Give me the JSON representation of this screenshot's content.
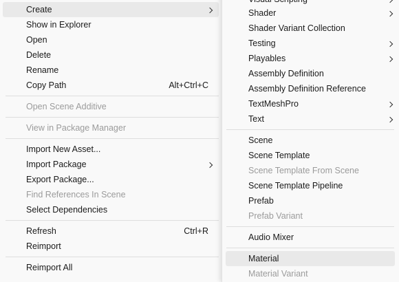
{
  "main_menu": {
    "items": [
      {
        "label": "Create",
        "has_submenu": true,
        "highlighted": true
      },
      {
        "label": "Show in Explorer"
      },
      {
        "label": "Open"
      },
      {
        "label": "Delete"
      },
      {
        "label": "Rename"
      },
      {
        "label": "Copy Path",
        "shortcut": "Alt+Ctrl+C"
      },
      {
        "label": "Open Scene Additive",
        "disabled": true
      },
      {
        "label": "View in Package Manager",
        "disabled": true
      },
      {
        "label": "Import New Asset..."
      },
      {
        "label": "Import Package",
        "has_submenu": true
      },
      {
        "label": "Export Package..."
      },
      {
        "label": "Find References In Scene",
        "disabled": true
      },
      {
        "label": "Select Dependencies"
      },
      {
        "label": "Refresh",
        "shortcut": "Ctrl+R"
      },
      {
        "label": "Reimport"
      },
      {
        "label": "Reimport All"
      }
    ]
  },
  "sub_menu": {
    "items": [
      {
        "label": "Visual Scripting",
        "has_submenu": true
      },
      {
        "label": "Shader",
        "has_submenu": true
      },
      {
        "label": "Shader Variant Collection"
      },
      {
        "label": "Testing",
        "has_submenu": true
      },
      {
        "label": "Playables",
        "has_submenu": true
      },
      {
        "label": "Assembly Definition"
      },
      {
        "label": "Assembly Definition Reference"
      },
      {
        "label": "TextMeshPro",
        "has_submenu": true
      },
      {
        "label": "Text",
        "has_submenu": true
      },
      {
        "label": "Scene"
      },
      {
        "label": "Scene Template"
      },
      {
        "label": "Scene Template From Scene",
        "disabled": true
      },
      {
        "label": "Scene Template Pipeline"
      },
      {
        "label": "Prefab"
      },
      {
        "label": "Prefab Variant",
        "disabled": true
      },
      {
        "label": "Audio Mixer"
      },
      {
        "label": "Material",
        "highlighted": true
      },
      {
        "label": "Material Variant",
        "disabled": true
      }
    ]
  },
  "colors": {
    "menu_background": "#f9f9f9",
    "highlight": "#e9e9e9",
    "disabled_text": "#9b9b9b",
    "separator": "#dedede"
  }
}
